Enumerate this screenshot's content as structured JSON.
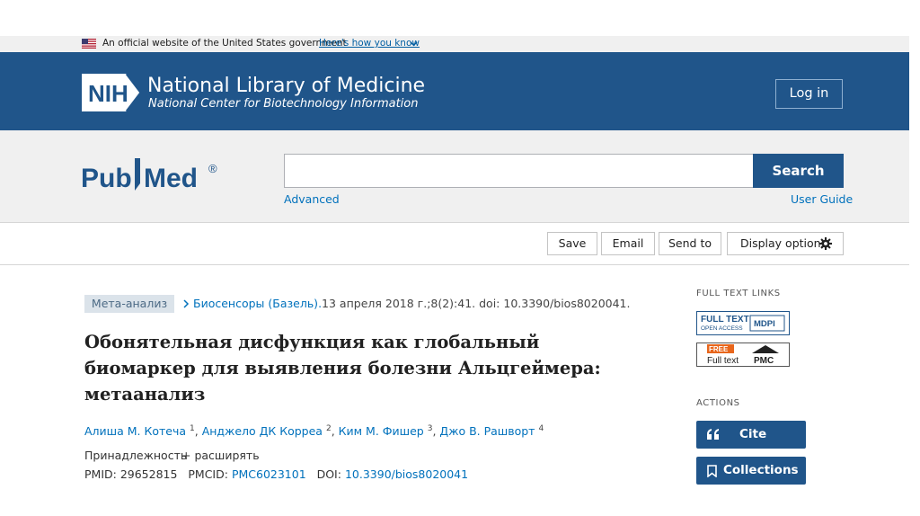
{
  "gov_banner": {
    "text": "An official website of the United States government",
    "link": "Here's how you know"
  },
  "header": {
    "nih_logo_text": "NIH",
    "title": "National Library of Medicine",
    "subtitle": "National Center for Biotechnology Information",
    "login_label": "Log in"
  },
  "search": {
    "logo_text_pub": "Pub",
    "logo_text_med": "Med",
    "logo_reg": "®",
    "input_value": "",
    "button_label": "Search",
    "advanced_label": "Advanced",
    "user_guide_label": "User Guide"
  },
  "toolbar": {
    "save_label": "Save",
    "email_label": "Email",
    "send_to_label": "Send to",
    "display_options_label": "Display options"
  },
  "article": {
    "publication_type": "Мета-анализ",
    "journal": "Биосенсоры (Базель).",
    "citation": "13 апреля 2018 г.;8(2):41. doi: 10.3390/bios8020041.",
    "title": "Обонятельная дисфункция как глобальный биомаркер для выявления болезни Альцгеймера: метаанализ",
    "authors": [
      {
        "name": "Алиша М. Котеча",
        "sup": "1"
      },
      {
        "name": "Анджело ДК Корреа",
        "sup": "2"
      },
      {
        "name": "Ким М. Фишер",
        "sup": "3"
      },
      {
        "name": "Джо В. Рашворт",
        "sup": "4"
      }
    ],
    "affiliation_label": "Принадлежность",
    "expand_label": "+ расширять",
    "pmid_label": "PMID: 29652815",
    "pmcid_label": "PMCID:",
    "pmcid_value": "PMC6023101",
    "doi_label": "DOI:",
    "doi_value": "10.3390/bios8020041"
  },
  "sidebar": {
    "full_text_heading": "FULL TEXT LINKS",
    "mdpi_badge": {
      "line1": "FULL TEXT",
      "line2": "OPEN ACCESS",
      "brand": "MDPI"
    },
    "pmc_badge": {
      "free": "FREE",
      "line2": "Full text",
      "brand": "PMC"
    },
    "actions_heading": "ACTIONS",
    "cite_label": "Cite",
    "collections_label": "Collections"
  },
  "colors": {
    "brand_blue": "#20558a",
    "link_blue": "#0071bc",
    "banner_gray": "#f0f0f0",
    "pmc_free_orange": "#e8661c"
  }
}
